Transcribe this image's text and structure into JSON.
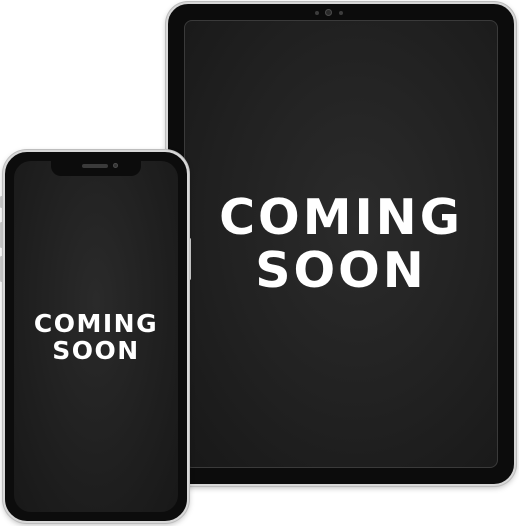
{
  "tablet": {
    "message_line1": "COMING",
    "message_line2": "SOON"
  },
  "phone": {
    "message_line1": "COMING",
    "message_line2": "SOON"
  },
  "colors": {
    "background": "#ffffff",
    "device_frame": "#0c0c0c",
    "screen": "#222222",
    "text": "#ffffff"
  }
}
